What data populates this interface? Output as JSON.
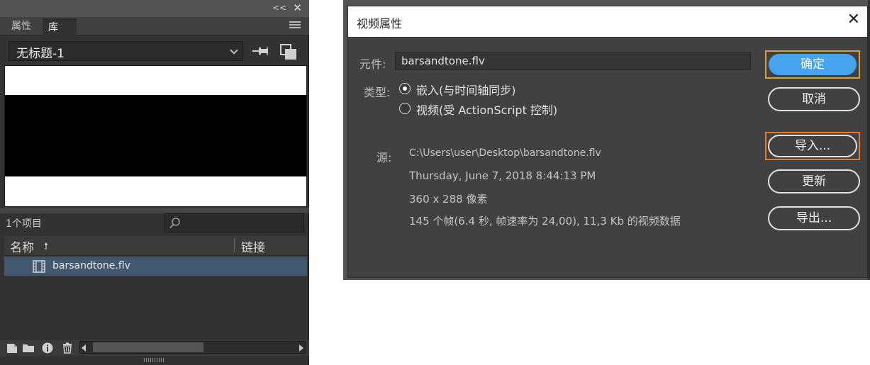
{
  "library_panel": {
    "collapse_glyph": "<<",
    "close_glyph": "✕",
    "tabs": [
      {
        "label": "属性",
        "active": false
      },
      {
        "label": "库",
        "active": true
      }
    ],
    "document_select": "无标题-1",
    "item_count": "1个项目",
    "columns": {
      "name": "名称",
      "sort_glyph": "🠕",
      "linkage": "链接"
    },
    "items": [
      {
        "icon": "video-icon",
        "name": "barsandtone.flv",
        "selected": true
      }
    ]
  },
  "dialog": {
    "title": "视频属性",
    "symbol_label": "元件:",
    "symbol_value": "barsandtone.flv",
    "type_label": "类型:",
    "type_options": [
      {
        "label": "嵌入(与时间轴同步)",
        "checked": true
      },
      {
        "label": "视频(受 ActionScript 控制)",
        "checked": false
      }
    ],
    "source_label": "源:",
    "source": {
      "path": "C:\\Users\\user\\Desktop\\barsandtone.flv",
      "date": "Thursday, June 7, 2018  8:44:13 PM",
      "dimensions": "360 x 288 像素",
      "info": "145 个帧(6.4 秒, 帧速率为 24,00), 11,3 Kb 的视频数据"
    },
    "buttons": {
      "ok": "确定",
      "cancel": "取消",
      "import": "导入...",
      "update": "更新",
      "export": "导出..."
    }
  },
  "colors": {
    "panel_bg": "#323232",
    "selection": "#41586f",
    "ok_button": "#46a3ee",
    "focus_outline_ok": "#d6a13a",
    "focus_outline_import": "#e87a2c"
  }
}
